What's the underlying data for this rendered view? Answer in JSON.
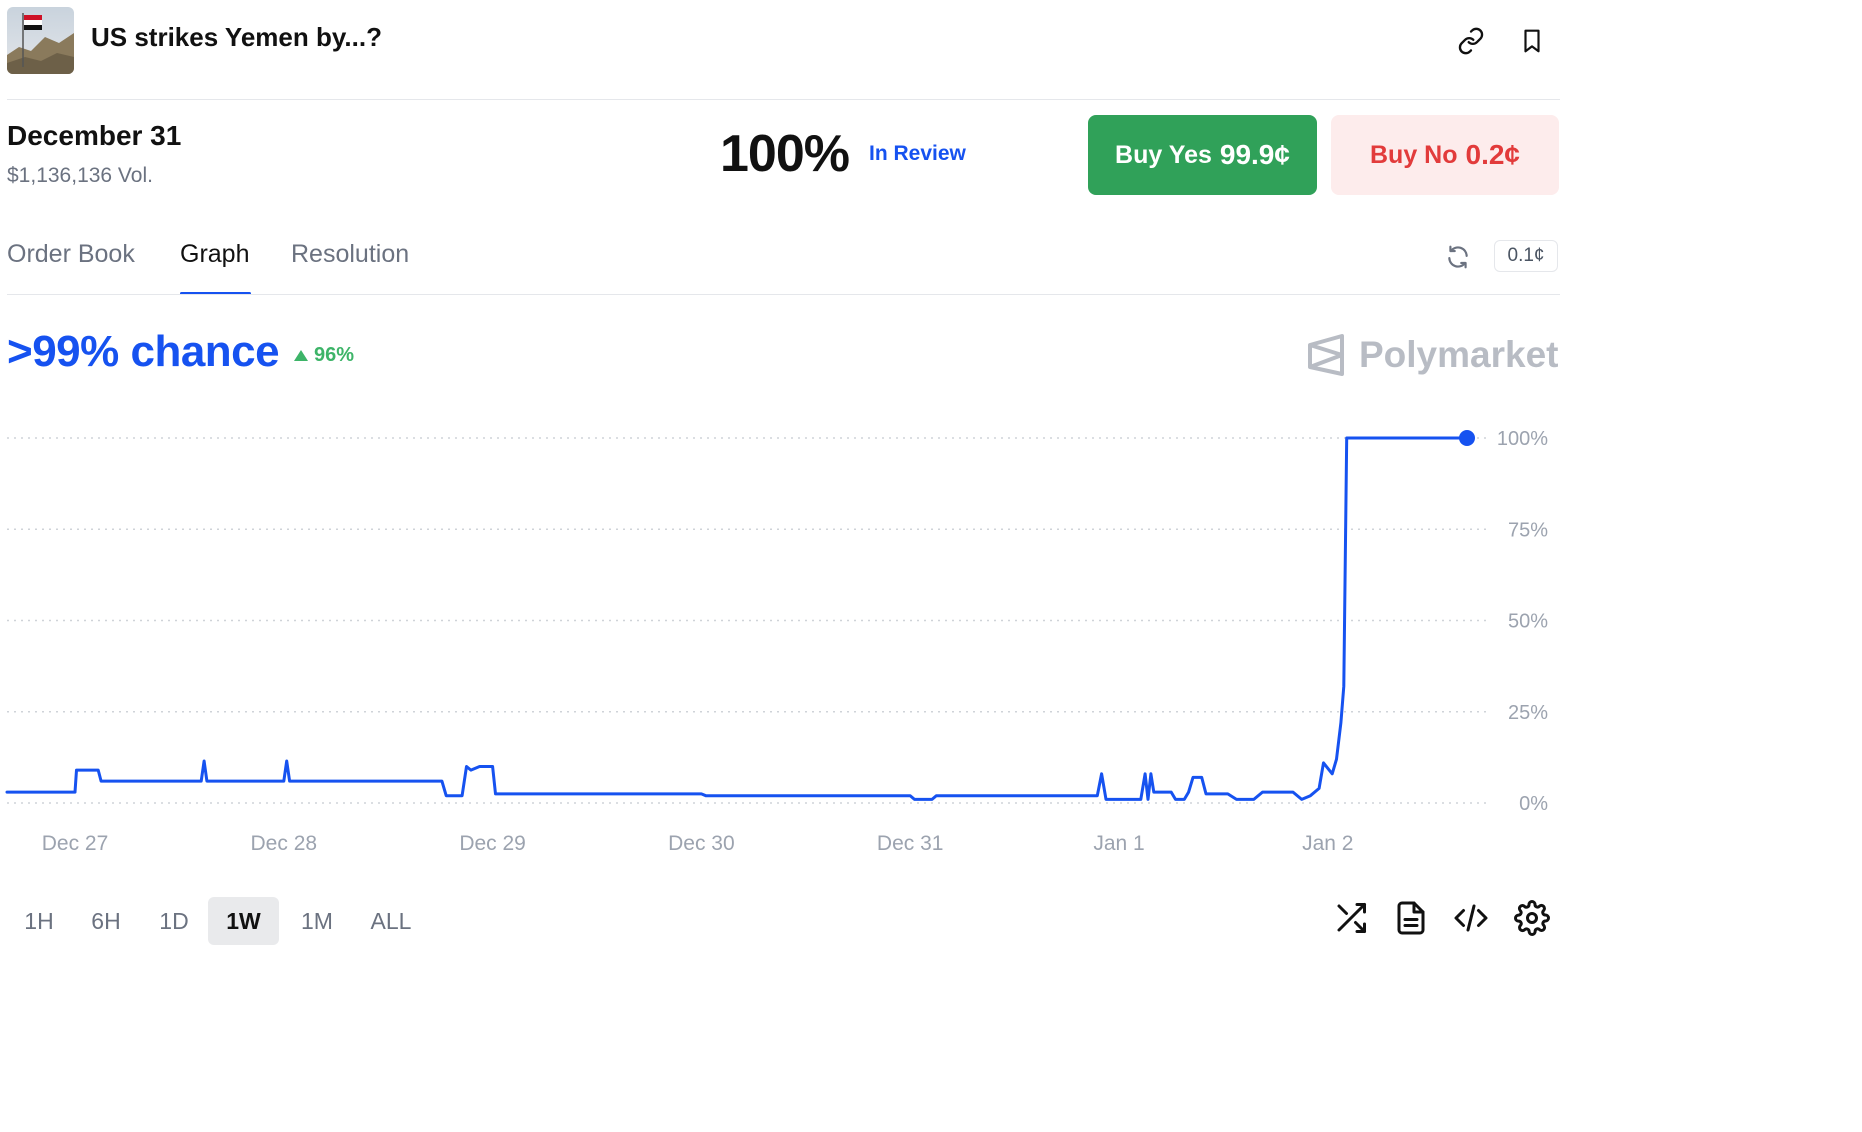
{
  "header": {
    "title": "US strikes Yemen by...?"
  },
  "outcome": {
    "name": "December 31",
    "volume": "$1,136,136 Vol.",
    "percent": "100%",
    "status": "In Review"
  },
  "buttons": {
    "yes_label": "Buy Yes",
    "yes_price": "99.9¢",
    "no_label": "Buy No",
    "no_price": "0.2¢"
  },
  "tabs": [
    {
      "label": "Order Book"
    },
    {
      "label": "Graph"
    },
    {
      "label": "Resolution"
    }
  ],
  "tick_size": "0.1¢",
  "chance": {
    "text": ">99% chance",
    "change": "96%"
  },
  "brand": "Polymarket",
  "ranges": [
    "1H",
    "6H",
    "1D",
    "1W",
    "1M",
    "ALL"
  ],
  "active_range": "1W",
  "icons": {
    "header": [
      "link-icon",
      "bookmark-icon"
    ],
    "tabs": [
      "refresh-icon"
    ],
    "tools": [
      "shuffle-icon",
      "document-icon",
      "code-icon",
      "gear-icon"
    ]
  },
  "colors": {
    "accent": "#1652f0",
    "yes": "#30a159",
    "no_bg": "#fdecec",
    "no_text": "#e23b3b",
    "up": "#3db468"
  },
  "chart_data": {
    "type": "line",
    "title": "",
    "xlabel": "",
    "ylabel": "",
    "ylim": [
      0,
      100
    ],
    "y_ticks": [
      "100%",
      "75%",
      "50%",
      "25%",
      "0%"
    ],
    "x_ticks": [
      "Dec 27",
      "Dec 28",
      "Dec 29",
      "Dec 30",
      "Dec 31",
      "Jan 1",
      "Jan 2"
    ],
    "grid": "horizontal dotted",
    "series": [
      {
        "color": "#1652f0",
        "points": [
          [
            "Dec 26 15:30",
            3
          ],
          [
            "Dec 27 00:00",
            3
          ],
          [
            "Dec 27 00:10",
            9
          ],
          [
            "Dec 27 02:40",
            9
          ],
          [
            "Dec 27 03:00",
            6
          ],
          [
            "Dec 27 14:30",
            6
          ],
          [
            "Dec 27 14:50",
            11.5
          ],
          [
            "Dec 27 15:10",
            6
          ],
          [
            "Dec 28 00:00",
            6
          ],
          [
            "Dec 28 00:20",
            11.5
          ],
          [
            "Dec 28 00:40",
            6
          ],
          [
            "Dec 28 18:10",
            6
          ],
          [
            "Dec 28 18:40",
            2
          ],
          [
            "Dec 28 20:30",
            2
          ],
          [
            "Dec 28 21:00",
            10
          ],
          [
            "Dec 28 21:30",
            9
          ],
          [
            "Dec 28 22:30",
            10
          ],
          [
            "Dec 29 00:00",
            10
          ],
          [
            "Dec 29 00:20",
            2.5
          ],
          [
            "Dec 30 00:00",
            2.5
          ],
          [
            "Dec 30 00:30",
            2
          ],
          [
            "Dec 31 00:00",
            2
          ],
          [
            "Dec 31 00:30",
            1
          ],
          [
            "Dec 31 02:30",
            1
          ],
          [
            "Dec 31 03:00",
            2
          ],
          [
            "Dec 31 21:30",
            2
          ],
          [
            "Dec 31 22:00",
            8
          ],
          [
            "Dec 31 22:30",
            1
          ],
          [
            "Jan 1 02:30",
            1
          ],
          [
            "Jan 1 03:00",
            8
          ],
          [
            "Jan 1 03:20",
            1
          ],
          [
            "Jan 1 03:40",
            8
          ],
          [
            "Jan 1 04:00",
            3
          ],
          [
            "Jan 1 06:00",
            3
          ],
          [
            "Jan 1 06:30",
            1
          ],
          [
            "Jan 1 07:30",
            1
          ],
          [
            "Jan 1 08:00",
            3
          ],
          [
            "Jan 1 08:30",
            7
          ],
          [
            "Jan 1 09:30",
            7
          ],
          [
            "Jan 1 10:00",
            2.5
          ],
          [
            "Jan 1 12:30",
            2.5
          ],
          [
            "Jan 1 13:30",
            1
          ],
          [
            "Jan 1 15:30",
            1
          ],
          [
            "Jan 1 16:30",
            3
          ],
          [
            "Jan 1 20:00",
            3
          ],
          [
            "Jan 1 21:00",
            1
          ],
          [
            "Jan 1 22:00",
            2
          ],
          [
            "Jan 1 23:00",
            4
          ],
          [
            "Jan 1 23:30",
            11
          ],
          [
            "Jan 2 00:30",
            8
          ],
          [
            "Jan 2 01:00",
            12
          ],
          [
            "Jan 2 01:30",
            22
          ],
          [
            "Jan 2 01:50",
            32
          ],
          [
            "Jan 2 02:10",
            100
          ],
          [
            "Jan 2 16:00",
            100
          ]
        ]
      }
    ]
  }
}
